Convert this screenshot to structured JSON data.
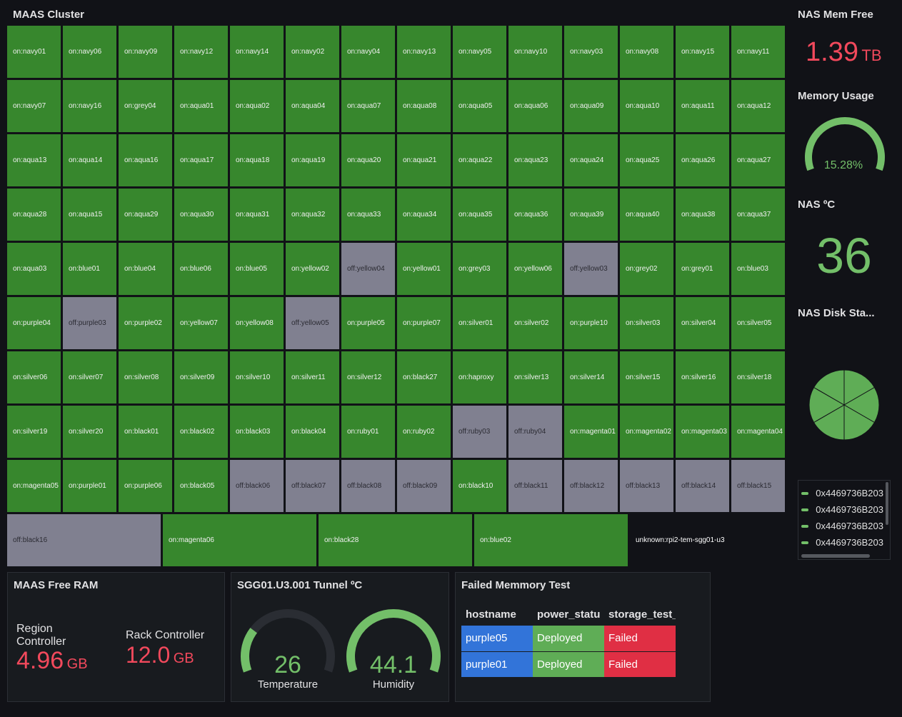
{
  "cluster": {
    "title": "MAAS Cluster",
    "rows": [
      [
        "on:navy01",
        "on:navy06",
        "on:navy09",
        "on:navy12",
        "on:navy14",
        "on:navy02",
        "on:navy04",
        "on:navy13",
        "on:navy05",
        "on:navy10",
        "on:navy03",
        "on:navy08",
        "on:navy15",
        "on:navy11"
      ],
      [
        "on:navy07",
        "on:navy16",
        "on:grey04",
        "on:aqua01",
        "on:aqua02",
        "on:aqua04",
        "on:aqua07",
        "on:aqua08",
        "on:aqua05",
        "on:aqua06",
        "on:aqua09",
        "on:aqua10",
        "on:aqua11",
        "on:aqua12"
      ],
      [
        "on:aqua13",
        "on:aqua14",
        "on:aqua16",
        "on:aqua17",
        "on:aqua18",
        "on:aqua19",
        "on:aqua20",
        "on:aqua21",
        "on:aqua22",
        "on:aqua23",
        "on:aqua24",
        "on:aqua25",
        "on:aqua26",
        "on:aqua27"
      ],
      [
        "on:aqua28",
        "on:aqua15",
        "on:aqua29",
        "on:aqua30",
        "on:aqua31",
        "on:aqua32",
        "on:aqua33",
        "on:aqua34",
        "on:aqua35",
        "on:aqua36",
        "on:aqua39",
        "on:aqua40",
        "on:aqua38",
        "on:aqua37"
      ],
      [
        "on:aqua03",
        "on:blue01",
        "on:blue04",
        "on:blue06",
        "on:blue05",
        "on:yellow02",
        "off:yellow04",
        "on:yellow01",
        "on:grey03",
        "on:yellow06",
        "off:yellow03",
        "on:grey02",
        "on:grey01",
        "on:blue03"
      ],
      [
        "on:purple04",
        "off:purple03",
        "on:purple02",
        "on:yellow07",
        "on:yellow08",
        "off:yellow05",
        "on:purple05",
        "on:purple07",
        "on:silver01",
        "on:silver02",
        "on:purple10",
        "on:silver03",
        "on:silver04",
        "on:silver05"
      ],
      [
        "on:silver06",
        "on:silver07",
        "on:silver08",
        "on:silver09",
        "on:silver10",
        "on:silver11",
        "on:silver12",
        "on:black27",
        "on:haproxy",
        "on:silver13",
        "on:silver14",
        "on:silver15",
        "on:silver16",
        "on:silver18"
      ],
      [
        "on:silver19",
        "on:silver20",
        "on:black01",
        "on:black02",
        "on:black03",
        "on:black04",
        "on:ruby01",
        "on:ruby02",
        "off:ruby03",
        "off:ruby04",
        "on:magenta01",
        "on:magenta02",
        "on:magenta03",
        "on:magenta04"
      ],
      [
        "on:magenta05",
        "on:purple01",
        "on:purple06",
        "on:black05",
        "off:black06",
        "off:black07",
        "off:black08",
        "off:black09",
        "on:black10",
        "off:black11",
        "off:black12",
        "off:black13",
        "off:black14",
        "off:black15"
      ]
    ],
    "last_row": [
      "off:black16",
      "on:magenta06",
      "on:black28",
      "on:blue02",
      "unknown:rpi2-tem-sgg01-u3"
    ]
  },
  "nas_mem_free": {
    "title": "NAS Mem Free",
    "value": "1.39",
    "unit": "TB"
  },
  "memory_usage": {
    "title": "Memory Usage",
    "value": "15.28%",
    "percent": 15.28
  },
  "nas_temp": {
    "title": "NAS ºC",
    "value": "36"
  },
  "nas_disk": {
    "title": "NAS Disk Sta...",
    "slices": 6,
    "legend": [
      "0x4469736B203",
      "0x4469736B203",
      "0x4469736B203",
      "0x4469736B203"
    ]
  },
  "maas_free_ram": {
    "title": "MAAS Free RAM",
    "region_label": "Region Controller",
    "region_value": "4.96",
    "region_unit": "GB",
    "rack_label": "Rack Controller",
    "rack_value": "12.0",
    "rack_unit": "GB"
  },
  "tunnel": {
    "title": "SGG01.U3.001 Tunnel ºC",
    "temp_value": "26",
    "temp_label": "Temperature",
    "temp_percent": 26,
    "hum_value": "44.1",
    "hum_label": "Humidity",
    "hum_percent": 100
  },
  "failed_test": {
    "title": "Failed Memmory Test",
    "headers": [
      "hostname",
      "power_statu",
      "storage_test_s"
    ],
    "rows": [
      [
        "purple05",
        "Deployed",
        "Failed"
      ],
      [
        "purple01",
        "Deployed",
        "Failed"
      ]
    ]
  },
  "colors": {
    "green": "#37872d",
    "gray": "#808090",
    "red": "#f2495c",
    "stat_green": "#73bf69"
  }
}
